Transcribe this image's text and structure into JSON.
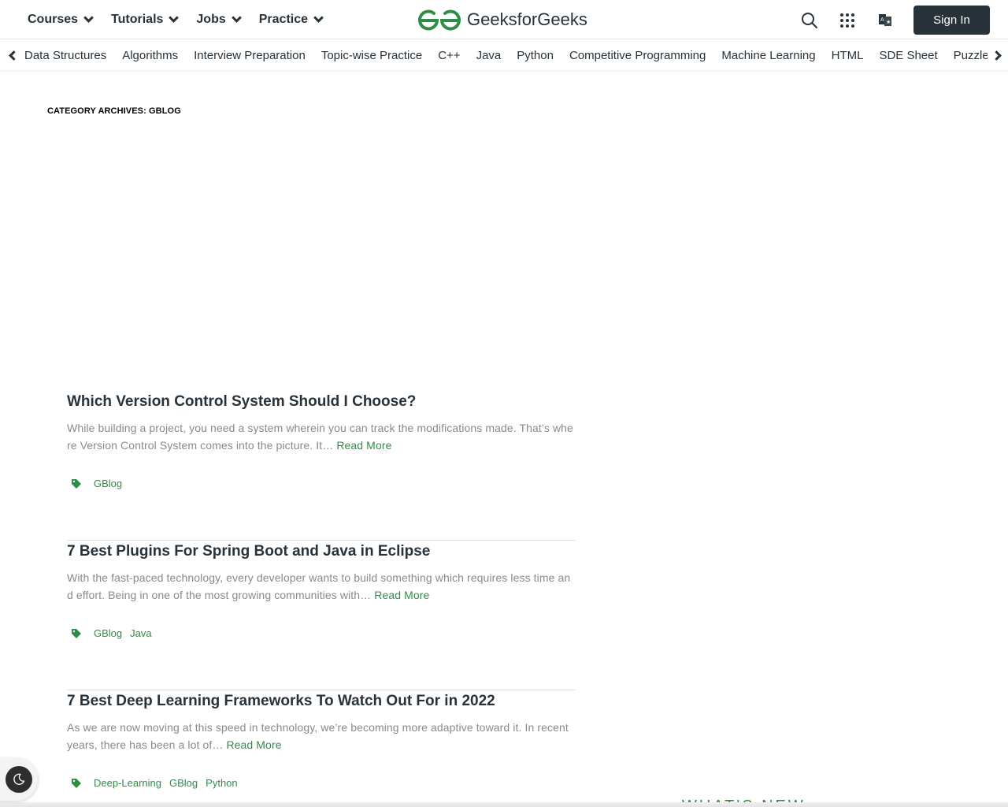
{
  "header": {
    "nav": [
      {
        "label": "Courses"
      },
      {
        "label": "Tutorials"
      },
      {
        "label": "Jobs"
      },
      {
        "label": "Practice"
      }
    ],
    "logo_text": "GeeksforGeeks",
    "brand_color": "#2f8d46",
    "icons": [
      "search-icon",
      "apps-grid-icon",
      "translate-icon"
    ],
    "signin_label": "Sign In"
  },
  "subnav": {
    "items": [
      "Data Structures",
      "Algorithms",
      "Interview Preparation",
      "Topic-wise Practice",
      "C++",
      "Java",
      "Python",
      "Competitive Programming",
      "Machine Learning",
      "HTML",
      "SDE Sheet",
      "Puzzles"
    ]
  },
  "main": {
    "archive_title": "CATEGORY ARCHIVES: GBLOG",
    "read_more_label": "Read More",
    "posts": [
      {
        "title": "Which Version Control System Should I Choose?",
        "excerpt": "While building a project, you need a system wherein you can track the modifications made. That’s where Version Control System comes into the picture. It…",
        "tags": [
          "GBlog"
        ]
      },
      {
        "title": "7 Best Plugins For Spring Boot and Java in Eclipse",
        "excerpt": "With the fast-paced technology, every developer wants to build something which requires less time and effort. Being in one of the most growing communities with…",
        "tags": [
          "GBlog",
          "Java"
        ]
      },
      {
        "title": "7 Best Deep Learning Frameworks To Watch Out For in 2022",
        "excerpt": "As we are now moving at this speed in technology, we’re becoming more adaptive toward it. In recent years, there has been a lot of…",
        "tags": [
          "Deep-Learning",
          "GBlog",
          "Python"
        ]
      }
    ]
  },
  "sidebar": {
    "whats_new_label": "WHAT'S NEW"
  },
  "dark_mode_toggle": {
    "icon": "moon-icon"
  }
}
